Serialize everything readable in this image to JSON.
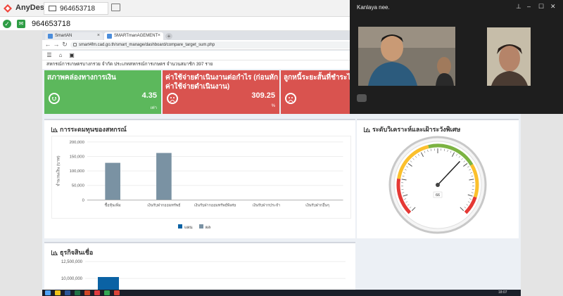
{
  "anydesk": {
    "app_name": "AnyDesk",
    "tab_label": "964653718",
    "address": "964653718"
  },
  "browser": {
    "tabs": [
      {
        "label": "SmartAN"
      },
      {
        "label": "SMARTmanAGEMENT"
      }
    ],
    "url": "smart4fm.cad.go.th/smart_manage/dashboard/compare_target_sum.php",
    "org_line": "สหกรณ์การเกษตรบางกรวย จำกัด ประเภทสหกรณ์การเกษตร จำนวนสมาชิก 397 ราย"
  },
  "kpis": [
    {
      "title": "สภาพคล่องทางการเงิน",
      "value": "4.35",
      "unit": "เท่า",
      "mood": "happy",
      "color": "#5cb85c"
    },
    {
      "title": "ค่าใช้จ่ายดำเนินงานต่อกำไร (ก่อนหักค่าใช้จ่ายดำเนินงาน)",
      "value": "309.25",
      "unit": "%",
      "mood": "sad",
      "color": "#d9534f"
    },
    {
      "title": "ลูกหนี้ระยะสั้นที่ชำระได้ตาม",
      "value": "",
      "unit": "",
      "mood": "sad",
      "color": "#d9534f"
    }
  ],
  "panels": {
    "capital": "การระดมทุนของสหกรณ์",
    "gauge": "ระดับวิเคราะห์และเฝ้าระวังพิเศษ",
    "loans": "ธุรกิจสินเชื่อ"
  },
  "chart_data": [
    {
      "type": "bar",
      "title": "",
      "ylabel": "จำนวนเงิน (บาท)",
      "ylim": [
        0,
        200000
      ],
      "yticks": [
        "200,000",
        "150,000",
        "100,000",
        "50,000",
        "0"
      ],
      "categories": [
        "ซื้อหุ้นเพิ่ม",
        "เงินรับฝากออมทรัพย์",
        "เงินรับฝากออมทรัพย์พิเศษ",
        "เงินรับฝากประจำ",
        "เงินรับฝากอื่นๆ"
      ],
      "series": [
        {
          "name": "แผน",
          "color": "#0b62a4",
          "values": [
            0,
            0,
            0,
            0,
            0
          ]
        },
        {
          "name": "ผล",
          "color": "#7a92a3",
          "values": [
            128000,
            162000,
            0,
            0,
            0
          ]
        }
      ]
    },
    {
      "type": "bar",
      "title": "",
      "yticks": [
        "12,500,000",
        "10,000,000"
      ],
      "series": [
        {
          "color": "#0b62a4",
          "values": [
            10000000
          ]
        }
      ]
    }
  ],
  "gauge": {
    "value": "66",
    "fraction": 0.66
  },
  "video": {
    "caller": "Kanlaya nee."
  },
  "taskbar": {
    "clock": "18:07"
  }
}
